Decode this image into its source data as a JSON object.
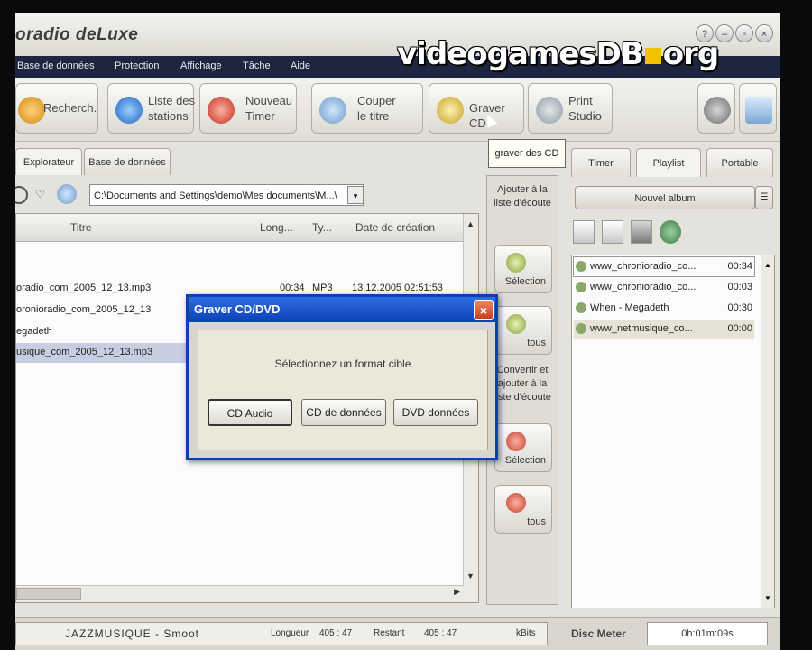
{
  "app": {
    "title": "oradio deLuxe"
  },
  "watermark": {
    "left": "videogamesDB",
    "right": "org"
  },
  "menu": [
    "Base de données",
    "Protection",
    "Affichage",
    "Tâche",
    "Aide"
  ],
  "toolbar": {
    "buttons": [
      {
        "label": "Recherch.",
        "icon": "search-icon"
      },
      {
        "label": "Liste des\nstations",
        "icon": "globe-icon"
      },
      {
        "label": "Nouveau\nTimer",
        "icon": "alarm-clock-icon"
      },
      {
        "label": "Couper\nle titre",
        "icon": "scissors-icon"
      },
      {
        "label": "Graver CD",
        "icon": "cd-burn-icon"
      },
      {
        "label": "Print\nStudio",
        "icon": "printer-icon"
      }
    ],
    "tooltip": "graver des CD"
  },
  "left_tabs": [
    "Explorateur",
    "Base de données"
  ],
  "path": "C:\\Documents and Settings\\demo\\Mes documents\\M...\\",
  "file_list": {
    "columns": [
      "Titre",
      "Long...",
      "Ty...",
      "Date de création"
    ],
    "rows": [
      {
        "title": "oradio_com_2005_12_13.mp3",
        "length": "00:34",
        "type": "MP3",
        "date": "13.12.2005 02:51:53"
      },
      {
        "title": "oronioradio_com_2005_12_13",
        "length": "",
        "type": "",
        "date": ""
      },
      {
        "title": "egadeth",
        "length": "",
        "type": "",
        "date": ""
      },
      {
        "title": "usique_com_2005_12_13.mp3",
        "length": "",
        "type": "",
        "date": ""
      }
    ]
  },
  "mid_panel": {
    "add_label": "Ajouter à la\nliste d'écoute",
    "selection": "Sélection",
    "all": "tous",
    "convert_label": "Convertir et\najouter à la\nliste d'écoute",
    "selection2": "Sélection",
    "all2": "tous"
  },
  "right_tabs": [
    "Timer",
    "Playlist",
    "Portable"
  ],
  "playlist": {
    "album_button": "Nouvel album",
    "items": [
      {
        "title": "www_chronioradio_co...",
        "duration": "00:34"
      },
      {
        "title": "www_chronioradio_co...",
        "duration": "00:03"
      },
      {
        "title": "When - Megadeth",
        "duration": "00:30"
      },
      {
        "title": "www_netmusique_co...",
        "duration": "00:00"
      }
    ]
  },
  "status": {
    "station": "JAZZMUSIQUE - Smoot",
    "length_label": "Longueur",
    "length_value": "405 : 47",
    "remaining_label": "Restant",
    "remaining_value": "405 : 47",
    "bitrate": "kBits",
    "disc_meter_label": "Disc Meter",
    "disc_meter_value": "0h:01m:09s"
  },
  "dialog": {
    "title": "Graver CD/DVD",
    "message": "Sélectionnez un format cible",
    "buttons": [
      "CD Audio",
      "CD de données",
      "DVD données"
    ]
  }
}
